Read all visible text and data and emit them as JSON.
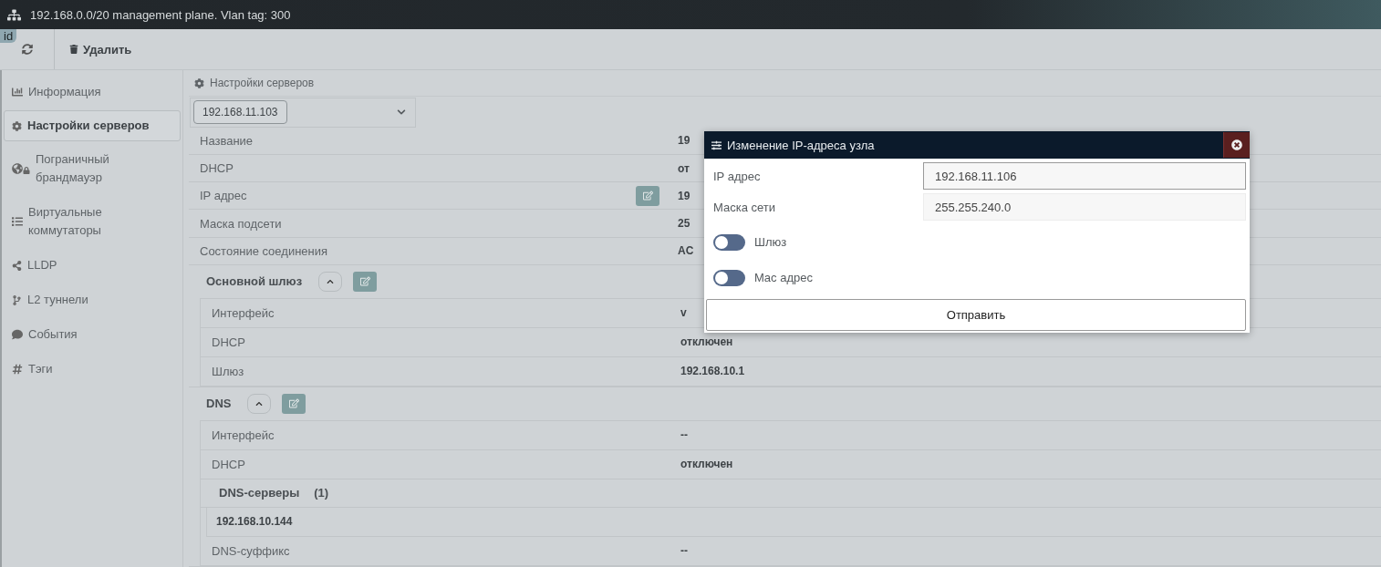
{
  "title_bar": {
    "text": "192.168.0.0/20 management plane. Vlan tag: 300"
  },
  "badge": "id",
  "toolbar": {
    "delete_label": "Удалить"
  },
  "sidebar": {
    "items": [
      {
        "label": "Информация",
        "selected": false
      },
      {
        "label": "Настройки серверов",
        "selected": true
      },
      {
        "label": "Пограничный брандмауэр",
        "selected": false
      },
      {
        "label": "Виртуальные коммутаторы",
        "selected": false
      },
      {
        "label": "LLDP",
        "selected": false
      },
      {
        "label": "L2 туннели",
        "selected": false
      },
      {
        "label": "События",
        "selected": false
      },
      {
        "label": "Тэги",
        "selected": false
      }
    ]
  },
  "panel_title": "Настройки серверов",
  "server_select": {
    "value": "192.168.11.103"
  },
  "properties": [
    {
      "label": "Название",
      "value": "19",
      "editable": false
    },
    {
      "label": "DHCP",
      "value": "от",
      "editable": false
    },
    {
      "label": "IP адрес",
      "value": "19",
      "editable": true
    },
    {
      "label": "Маска подсети",
      "value": "25",
      "editable": false
    },
    {
      "label": "Состояние соединения",
      "value": "AC",
      "editable": false
    }
  ],
  "sections": [
    {
      "title": "Основной шлюз",
      "expanded": true,
      "rows": [
        {
          "kind": "pair",
          "label": "Интерфейс",
          "value": "v"
        },
        {
          "kind": "pair",
          "label": "DHCP",
          "value": "отключен"
        },
        {
          "kind": "pair",
          "label": "Шлюз",
          "value": "192.168.10.1"
        }
      ]
    },
    {
      "title": "DNS",
      "expanded": true,
      "rows": [
        {
          "kind": "pair",
          "label": "Интерфейс",
          "value": "--"
        },
        {
          "kind": "pair",
          "label": "DHCP",
          "value": "отключен"
        },
        {
          "kind": "group",
          "title": "DNS-серверы",
          "count": "(1)",
          "items": [
            "192.168.10.144"
          ]
        },
        {
          "kind": "pair",
          "label": "DNS-суффикс",
          "value": "--"
        }
      ]
    }
  ],
  "dialog": {
    "title": "Изменение IP-адреса узла",
    "fields": [
      {
        "label": "IP адрес",
        "value": "192.168.11.106",
        "focused": true
      },
      {
        "label": "Маска сети",
        "value": "255.255.240.0",
        "focused": false
      }
    ],
    "toggles": [
      {
        "label": "Шлюз",
        "on": false
      },
      {
        "label": "Mac адрес",
        "on": false
      }
    ],
    "submit": "Отправить"
  }
}
